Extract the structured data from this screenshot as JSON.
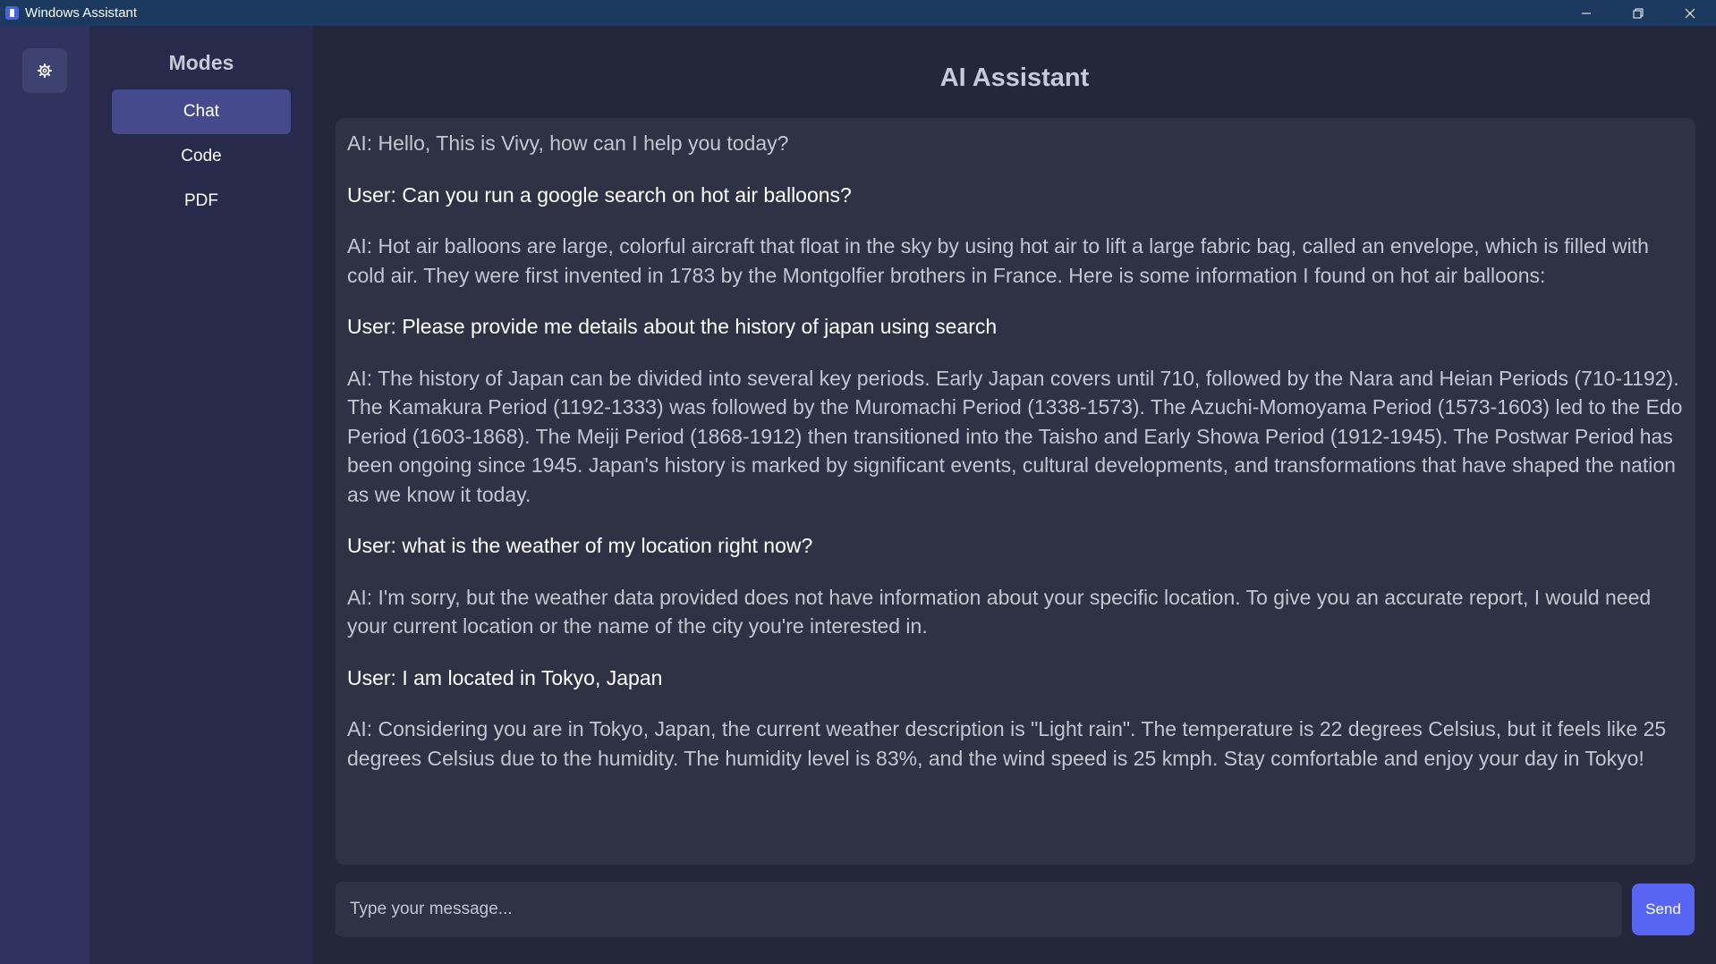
{
  "window": {
    "title": "Windows Assistant",
    "controls": [
      "minimize-icon",
      "restore-icon",
      "close-icon"
    ]
  },
  "rail": {
    "settings_icon": "gear-icon"
  },
  "sidebar": {
    "title": "Modes",
    "active_mode": "Chat",
    "modes": [
      {
        "label": "Chat"
      },
      {
        "label": "Code"
      },
      {
        "label": "PDF"
      }
    ]
  },
  "main": {
    "title": "AI Assistant"
  },
  "chat": {
    "messages": [
      {
        "role": "ai",
        "text": "AI: Hello, This is Vivy, how can I help you today?"
      },
      {
        "role": "user",
        "text": "User: Can you run a google search on hot air balloons?"
      },
      {
        "role": "ai",
        "text": "AI: Hot air balloons are large, colorful aircraft that float in the sky by using hot air to lift a large fabric bag, called an envelope, which is filled with cold air. They were first invented in 1783 by the Montgolfier brothers in France. Here is some information I found on hot air balloons:"
      },
      {
        "role": "user",
        "text": "User: Please provide me details about the history of japan using search"
      },
      {
        "role": "ai",
        "text": "AI: The history of Japan can be divided into several key periods. Early Japan covers until 710, followed by the Nara and Heian Periods (710-1192). The Kamakura Period (1192-1333) was followed by the Muromachi Period (1338-1573). The Azuchi-Momoyama Period (1573-1603) led to the Edo Period (1603-1868). The Meiji Period (1868-1912) then transitioned into the Taisho and Early Showa Period (1912-1945). The Postwar Period has been ongoing since 1945. Japan's history is marked by significant events, cultural developments, and transformations that have shaped the nation as we know it today."
      },
      {
        "role": "user",
        "text": "User: what is the weather of my location right now?"
      },
      {
        "role": "ai",
        "text": "AI: I'm sorry, but the weather data provided does not have information about your specific location. To give you an accurate report, I would need your current location or the name of the city you're interested in."
      },
      {
        "role": "user",
        "text": "User: I am located in Tokyo, Japan"
      },
      {
        "role": "ai",
        "text": "AI: Considering you are in Tokyo, Japan, the current weather description is \"Light rain\". The temperature is 22 degrees Celsius, but it feels like 25 degrees Celsius due to the humidity. The humidity level is 83%, and the wind speed is 25 kmph. Stay comfortable and enjoy your day in Tokyo!"
      }
    ]
  },
  "composer": {
    "placeholder": "Type your message...",
    "value": "",
    "send_label": "Send"
  },
  "colors": {
    "titlebar": "#1c3a5f",
    "rail": "#30335d",
    "sidebar": "#272a4a",
    "active_mode": "#454a8c",
    "background": "#24263a",
    "panel": "#2f3145",
    "accent": "#5865f2"
  }
}
